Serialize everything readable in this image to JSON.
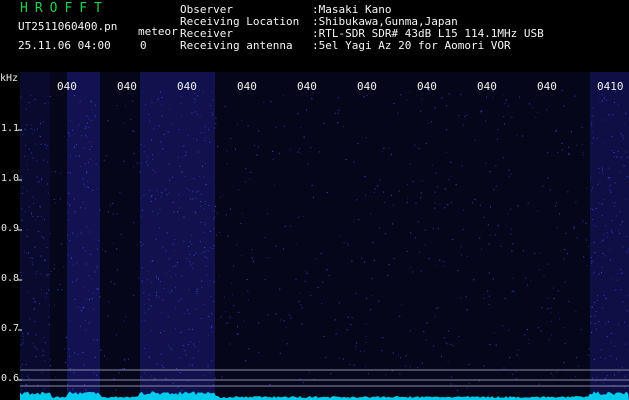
{
  "header": {
    "app_title": "HROFFT",
    "file_name": "UT2511060400.pn",
    "meteor_tag": "meteor",
    "datetime": "25.11.06 04:00",
    "count": "0",
    "info": [
      {
        "label": "Observer",
        "value": ":Masaki Kano"
      },
      {
        "label": "Receiving Location",
        "value": ":Shibukawa,Gunma,Japan"
      },
      {
        "label": "Receiver",
        "value": ":RTL-SDR SDR# 43dB L15 114.1MHz USB"
      },
      {
        "label": "Receiving antenna",
        "value": ":5el Yagi Az 20 for Aomori VOR"
      }
    ]
  },
  "chart_data": {
    "type": "heatmap",
    "ylabel": "kHz",
    "y_ticks": [
      "1.1",
      "1.0",
      "0.9",
      "0.8",
      "0.7",
      "0.6"
    ],
    "x_ticks": [
      "040",
      "040",
      "040",
      "040",
      "040",
      "040",
      "040",
      "040",
      "040",
      "0410"
    ],
    "colors": {
      "background": "#000000",
      "spectrum_dark": "#06061a",
      "spectrum_bright": "#14145a",
      "noise_dot": "#3a52ff",
      "signal_line": "#00e0ff",
      "text": "#f5f5f5",
      "title": "#1fd04b"
    }
  }
}
